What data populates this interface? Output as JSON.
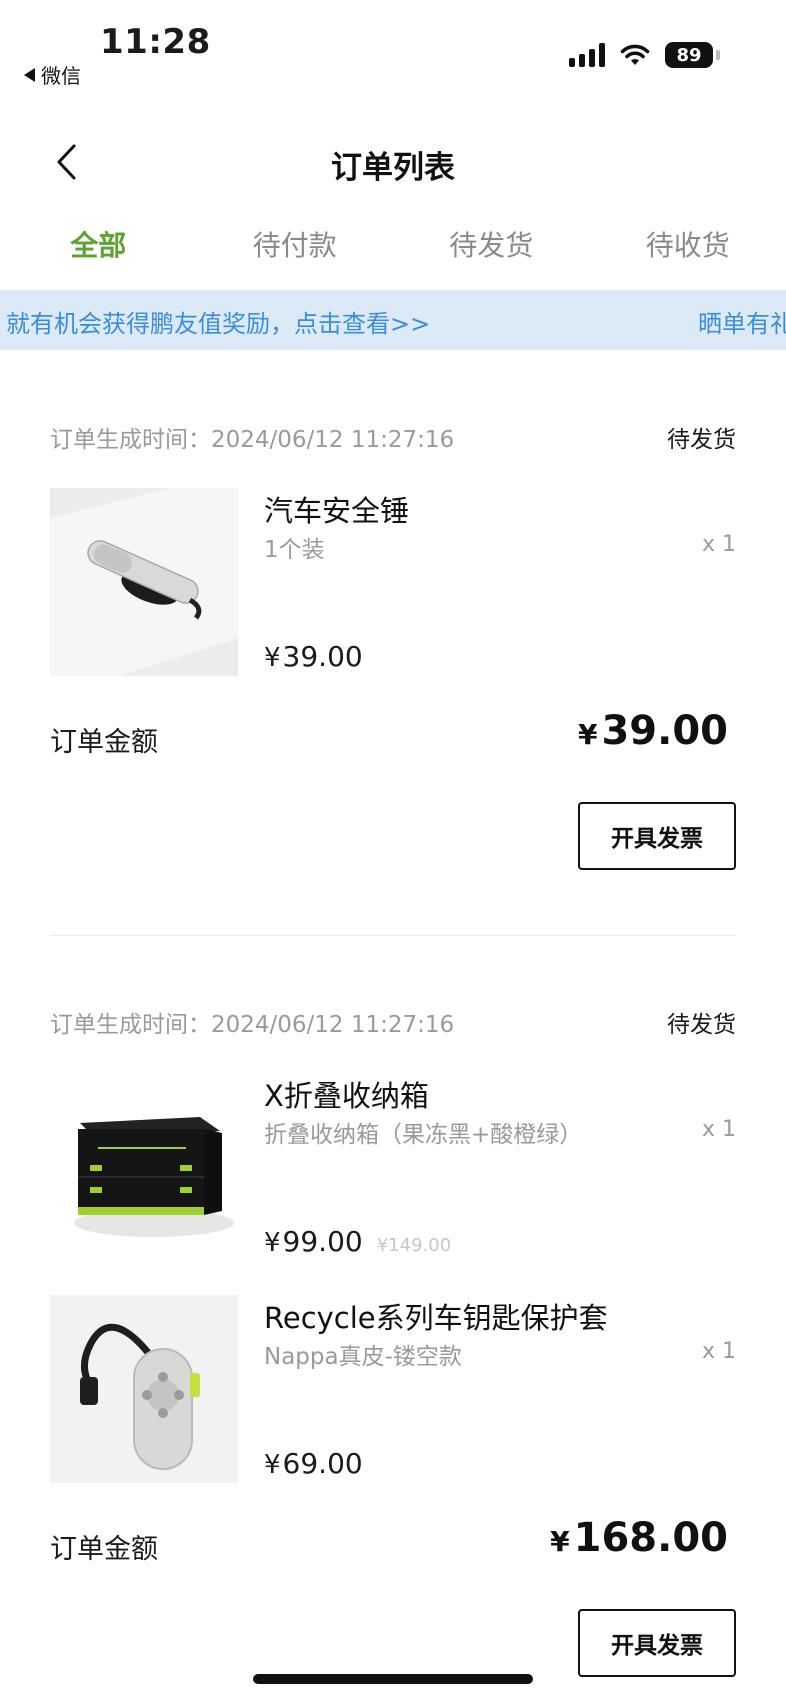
{
  "status_bar": {
    "time": "11:28",
    "back_app_label": "微信",
    "battery_level": "89"
  },
  "nav": {
    "title": "订单列表"
  },
  "tabs": [
    {
      "label": "全部",
      "active": true
    },
    {
      "label": "待付款",
      "active": false
    },
    {
      "label": "待发货",
      "active": false
    },
    {
      "label": "待收货",
      "active": false
    }
  ],
  "notice": {
    "text_1": "就有机会获得鹏友值奖励，点击查看>>",
    "text_2": "晒单有礼"
  },
  "orders": [
    {
      "time_label": "订单生成时间：",
      "time_value": "2024/06/12 11:27:16",
      "status": "待发货",
      "items": [
        {
          "name": "汽车安全锤",
          "spec": "1个装",
          "qty": "x 1",
          "currency": "¥",
          "price": "39.00"
        }
      ],
      "total_label": "订单金额",
      "total_currency": "¥",
      "total_value": "39.00",
      "invoice_label": "开具发票"
    },
    {
      "time_label": "订单生成时间：",
      "time_value": "2024/06/12 11:27:16",
      "status": "待发货",
      "items": [
        {
          "name": "X折叠收纳箱",
          "spec": "折叠收纳箱（果冻黑+酸橙绿）",
          "qty": "x 1",
          "currency": "¥",
          "price": "99.00",
          "original_price": "¥149.00"
        },
        {
          "name": "Recycle系列车钥匙保护套",
          "spec": "Nappa真皮-镂空款",
          "qty": "x 1",
          "currency": "¥",
          "price": "69.00"
        }
      ],
      "total_label": "订单金额",
      "total_currency": "¥",
      "total_value": "168.00",
      "invoice_label": "开具发票"
    }
  ],
  "colors": {
    "accent_green": "#5da233",
    "notice_bg": "#dce9f7",
    "notice_text": "#3a8ed8"
  }
}
